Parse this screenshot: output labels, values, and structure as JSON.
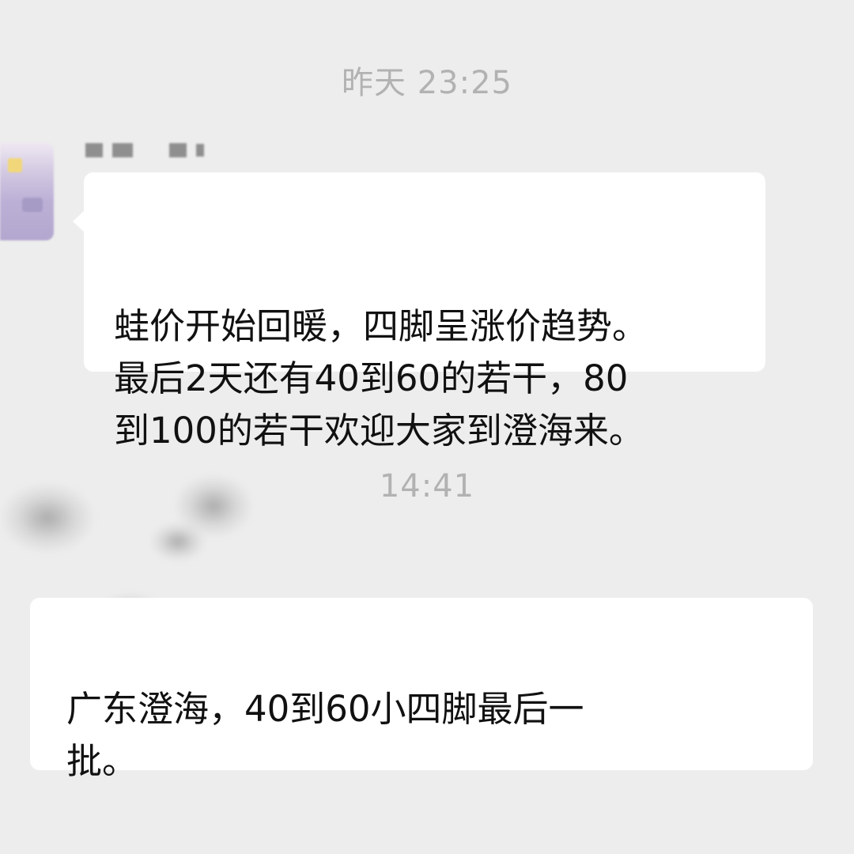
{
  "chat": {
    "timestamp_1": "昨天 23:25",
    "sender_1_name": "",
    "message_1": "蛙价开始回暖，四脚呈涨价趋势。\n最后2天还有40到60的若干，80\n到100的若干欢迎大家到澄海来。",
    "timestamp_2": "14:41",
    "sender_2_name": "",
    "message_2": "广东澄海，40到60小四脚最后一\n批。"
  },
  "colors": {
    "background": "#ededed",
    "bubble": "#ffffff",
    "timestamp_text": "#b2b2b2",
    "message_text": "#111111"
  },
  "icons": {
    "avatar_1": "blurred-avatar",
    "avatar_2": "blurred-avatar"
  }
}
